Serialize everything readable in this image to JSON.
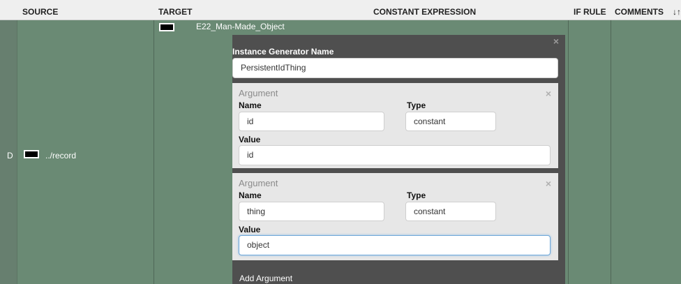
{
  "header": {
    "source": "SOURCE",
    "target": "TARGET",
    "constant_expression": "CONSTANT EXPRESSION",
    "if_rule": "IF RULE",
    "comments": "COMMENTS",
    "sort_icon_text": "↓↑"
  },
  "row": {
    "letter": "D",
    "source_path": "../record",
    "target_label": "E22_Man-Made_Object"
  },
  "modal": {
    "title": "Instance Generator Name",
    "generator_value": "PersistentIdThing",
    "close_icon": "×",
    "arguments": [
      {
        "header": "Argument",
        "name_label": "Name",
        "type_label": "Type",
        "value_label": "Value",
        "name": "id",
        "type": "constant",
        "value": "id"
      },
      {
        "header": "Argument",
        "name_label": "Name",
        "type_label": "Type",
        "value_label": "Value",
        "name": "thing",
        "type": "constant",
        "value": "object"
      }
    ],
    "add_argument": "Add Argument"
  },
  "colors": {
    "background": "#6e8f78",
    "header_bg": "#efefef",
    "modal_bg": "#4f4f4f",
    "argument_bg": "#e7e7e7",
    "focus_border": "#6ea7d8"
  }
}
